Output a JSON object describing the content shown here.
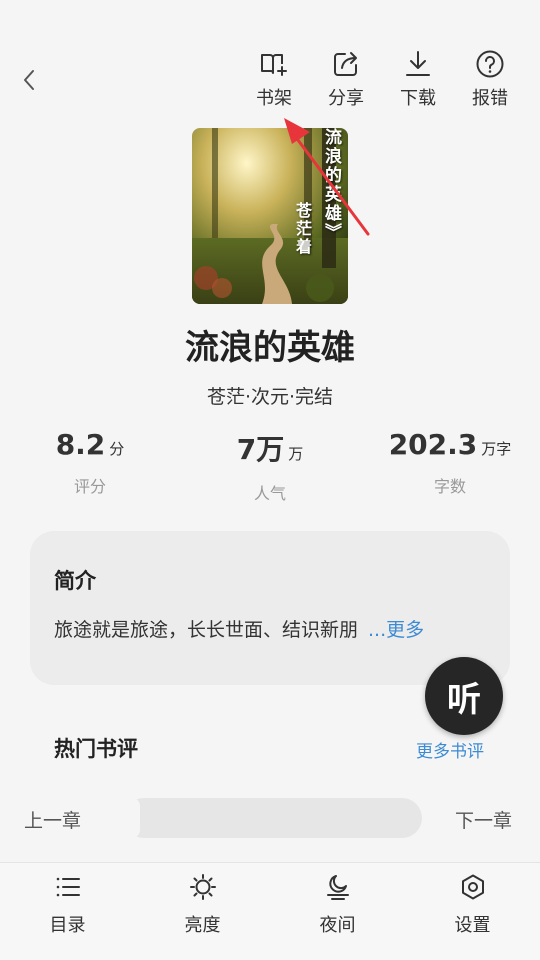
{
  "header": {
    "actions": [
      {
        "label": "书架",
        "icon": "bookshelf-add-icon"
      },
      {
        "label": "分享",
        "icon": "share-icon"
      },
      {
        "label": "下载",
        "icon": "download-icon"
      },
      {
        "label": "报错",
        "icon": "help-icon"
      }
    ]
  },
  "book": {
    "cover_title": "流浪的英雄》",
    "cover_author": "苍茫着",
    "title": "流浪的英雄",
    "meta": "苍茫·次元·完结"
  },
  "stats": [
    {
      "value": "8.2",
      "unit": "分",
      "label": "评分"
    },
    {
      "value": "7万",
      "unit": "万",
      "label": "人气"
    },
    {
      "value": "202.3",
      "unit": "万字",
      "label": "字数"
    }
  ],
  "intro": {
    "heading": "简介",
    "text": "旅途就是旅途，长长世面、结识新朋",
    "more": "...更多"
  },
  "listen": {
    "label": "听"
  },
  "reviews": {
    "heading": "热门书评",
    "more": "更多书评"
  },
  "chapter": {
    "prev": "上一章",
    "next": "下一章",
    "progress": 0
  },
  "bottom_nav": [
    {
      "label": "目录",
      "icon": "catalog-icon"
    },
    {
      "label": "亮度",
      "icon": "brightness-icon"
    },
    {
      "label": "夜间",
      "icon": "night-mode-icon"
    },
    {
      "label": "设置",
      "icon": "settings-icon"
    }
  ],
  "colors": {
    "accent_link": "#3d8bd3",
    "annotation_arrow": "#e8353b",
    "fab": "#262626"
  }
}
